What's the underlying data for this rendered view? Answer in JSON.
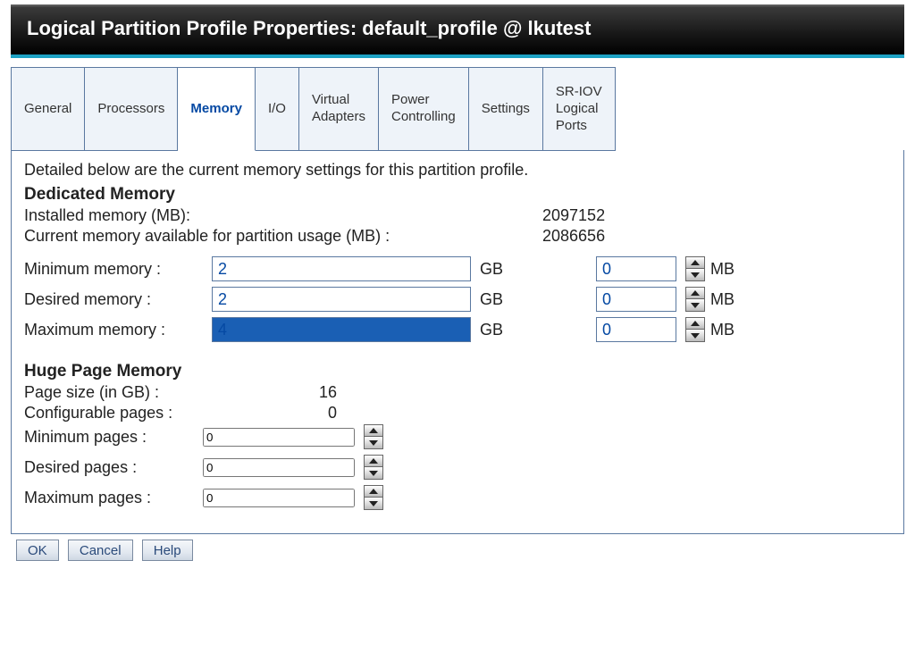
{
  "title": "Logical Partition Profile Properties: default_profile @ lkutest",
  "tabs": [
    "General",
    "Processors",
    "Memory",
    "I/O",
    "Virtual\nAdapters",
    "Power\nControlling",
    "Settings",
    "SR-IOV\nLogical\nPorts"
  ],
  "active_tab_index": 2,
  "intro": "Detailed below are the current memory settings for this partition profile.",
  "dedicated": {
    "heading": "Dedicated Memory",
    "installed_label": "Installed memory (MB):",
    "installed_value": "2097152",
    "available_label": "Current memory available for partition usage (MB) :",
    "available_value": "2086656",
    "rows": {
      "min": {
        "label": "Minimum memory :",
        "gb": "2",
        "mb": "0"
      },
      "des": {
        "label": "Desired memory :",
        "gb": "2",
        "mb": "0"
      },
      "max": {
        "label": "Maximum memory :",
        "gb": "4",
        "mb": "0"
      }
    },
    "unit_gb": "GB",
    "unit_mb": "MB"
  },
  "hugepage": {
    "heading": "Huge Page Memory",
    "pagesize_label": "Page size (in GB) :",
    "pagesize_value": "16",
    "configurable_label": "Configurable pages :",
    "configurable_value": "0",
    "rows": {
      "min": {
        "label": "Minimum pages :",
        "val": "0"
      },
      "des": {
        "label": "Desired pages :",
        "val": "0"
      },
      "max": {
        "label": "Maximum pages :",
        "val": "0"
      }
    }
  },
  "buttons": {
    "ok": "OK",
    "cancel": "Cancel",
    "help": "Help"
  }
}
